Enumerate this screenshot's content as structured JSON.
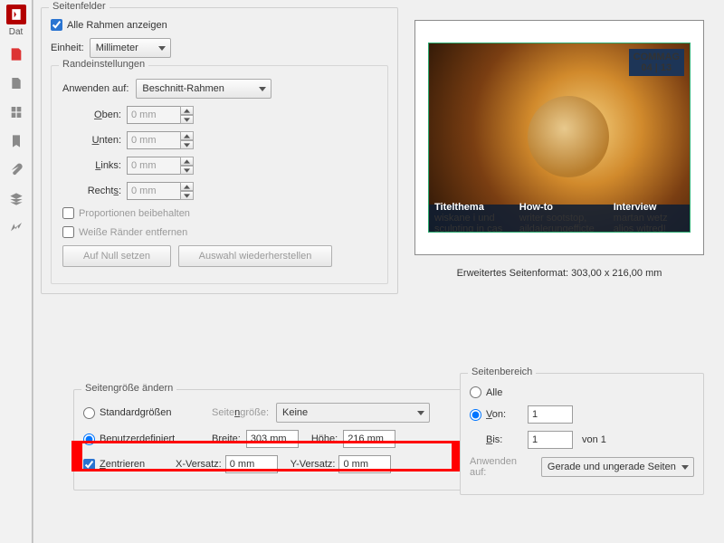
{
  "sidebar": {
    "tab_label": "Dat"
  },
  "page_fields": {
    "legend": "Seitenfelder",
    "show_frames": "Alle Rahmen anzeigen",
    "unit_label": "Einheit:",
    "unit_value": "Millimeter",
    "margins": {
      "legend": "Randeinstellungen",
      "apply_to_label": "Anwenden auf:",
      "apply_to_value": "Beschnitt-Rahmen",
      "top_label": "Oben:",
      "bottom_label": "Unten:",
      "left_label": "Links:",
      "right_label": "Rechts:",
      "value": "0 mm",
      "keep_proportions": "Proportionen beibehalten",
      "remove_white": "Weiße Ränder entfernen",
      "btn_zero": "Auf Null setzen",
      "btn_restore": "Auswahl wiederherstellen"
    }
  },
  "preview": {
    "badge_line1": "COMMAG",
    "badge_line2": "04 | 13",
    "col1_title": "Titelthema",
    "col1_sub": "wiskane i und sculpting in cas",
    "col2_title": "How-to",
    "col2_sub": "writer sootstop, aildalerungefficte",
    "col3_title": "Interview",
    "col3_sub": "martan wetz alios witred!",
    "extended_format": "Erweitertes Seitenformat: 303,00 x 216,00 mm"
  },
  "page_size": {
    "legend": "Seitengröße ändern",
    "standard_sizes": "Standardgrößen",
    "page_size_label": "Seitengröße:",
    "page_size_value": "Keine",
    "custom": "Benutzerdefiniert",
    "width_label": "Breite:",
    "width_value": "303 mm",
    "height_label": "Höhe:",
    "height_value": "216 mm",
    "center": "Zentrieren",
    "x_offset_label": "X-Versatz:",
    "x_offset_value": "0 mm",
    "y_offset_label": "Y-Versatz:",
    "y_offset_value": "0 mm"
  },
  "page_range": {
    "legend": "Seitenbereich",
    "all": "Alle",
    "from_label": "Von:",
    "from_value": "1",
    "to_label": "Bis:",
    "to_value": "1",
    "of_label": "von 1",
    "apply_to_label": "Anwenden auf:",
    "apply_to_value": "Gerade und ungerade Seiten"
  }
}
